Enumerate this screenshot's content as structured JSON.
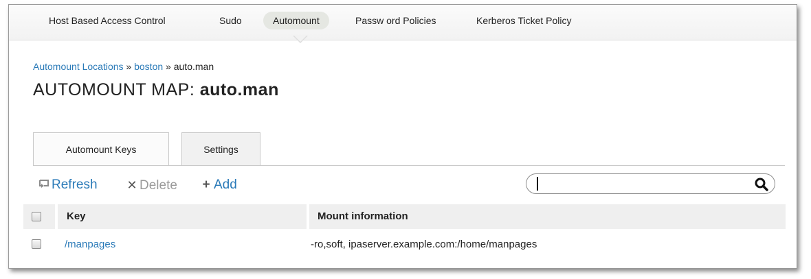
{
  "topnav": {
    "items": [
      {
        "label": "Host Based Access Control"
      },
      {
        "label": "Sudo"
      },
      {
        "label": "Automount"
      },
      {
        "label": "Passw ord Policies"
      },
      {
        "label": "Kerberos Ticket Policy"
      }
    ],
    "active": "Automount"
  },
  "breadcrumb": {
    "items": [
      "Automount Locations",
      "boston"
    ],
    "separator": "»",
    "current": "auto.man"
  },
  "title": {
    "prefix": "AUTOMOUNT MAP:",
    "name": "auto.man"
  },
  "tabs": [
    {
      "label": "Automount Keys",
      "active": true
    },
    {
      "label": "Settings",
      "active": false
    }
  ],
  "toolbar": {
    "refresh_label": "Refresh",
    "delete_label": "Delete",
    "add_label": "Add",
    "refresh_icon": "refresh-icon",
    "delete_icon": "x-icon",
    "add_icon": "plus-icon"
  },
  "search": {
    "value": "",
    "icon": "magnifier-icon"
  },
  "table": {
    "columns": [
      "Key",
      "Mount information"
    ],
    "rows": [
      {
        "key": "/manpages",
        "mount_info": "-ro,soft, ipaserver.example.com:/home/manpages",
        "checked": false
      }
    ]
  },
  "colors": {
    "link": "#2a7ab8",
    "active_nav": "#e5e7e2",
    "disabled": "#9a9a9a"
  }
}
